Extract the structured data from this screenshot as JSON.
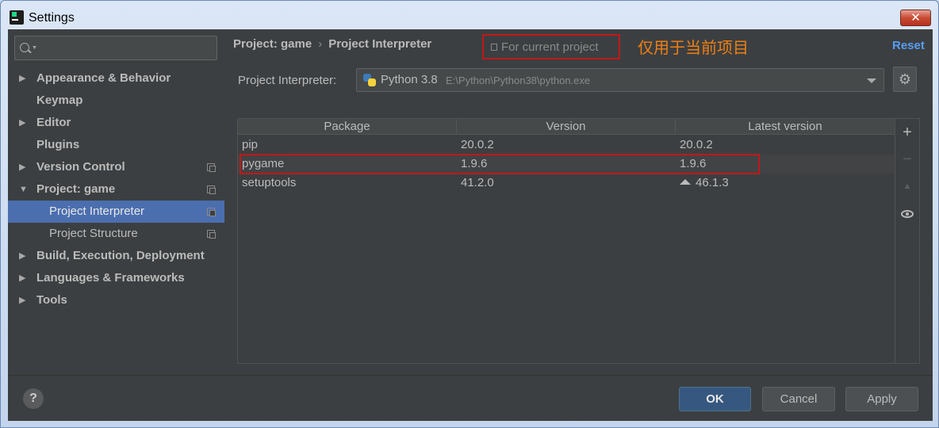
{
  "window": {
    "title": "Settings",
    "close_label": "✕"
  },
  "search": {
    "placeholder": ""
  },
  "sidebar": {
    "items": [
      {
        "label": "Appearance & Behavior",
        "arrow": "▶",
        "bold": true
      },
      {
        "label": "Keymap",
        "arrow": "",
        "bold": true
      },
      {
        "label": "Editor",
        "arrow": "▶",
        "bold": true
      },
      {
        "label": "Plugins",
        "arrow": "",
        "bold": true
      },
      {
        "label": "Version Control",
        "arrow": "▶",
        "bold": true,
        "project_icon": true
      },
      {
        "label": "Project: game",
        "arrow": "▼",
        "bold": true,
        "project_icon": true
      },
      {
        "label": "Project Interpreter",
        "arrow": "",
        "bold": false,
        "child": true,
        "selected": true,
        "project_icon": true
      },
      {
        "label": "Project Structure",
        "arrow": "",
        "bold": false,
        "child": true,
        "project_icon": true
      },
      {
        "label": "Build, Execution, Deployment",
        "arrow": "▶",
        "bold": true
      },
      {
        "label": "Languages & Frameworks",
        "arrow": "▶",
        "bold": true
      },
      {
        "label": "Tools",
        "arrow": "▶",
        "bold": true
      }
    ]
  },
  "header": {
    "breadcrumb": [
      "Project: game",
      "›",
      "Project Interpreter"
    ],
    "scope_text": "For current project",
    "annotation": "仅用于当前项目",
    "reset_label": "Reset"
  },
  "interpreter": {
    "label": "Project Interpreter:",
    "name": "Python 3.8",
    "path": "E:\\Python\\Python38\\python.exe"
  },
  "table": {
    "headers": [
      "Package",
      "Version",
      "Latest version"
    ],
    "rows": [
      {
        "package": "pip",
        "version": "20.0.2",
        "latest": "20.0.2",
        "upgrade": false
      },
      {
        "package": "pygame",
        "version": "1.9.6",
        "latest": "1.9.6",
        "upgrade": false
      },
      {
        "package": "setuptools",
        "version": "41.2.0",
        "latest": "46.1.3",
        "upgrade": true
      }
    ]
  },
  "toolbar": {
    "add": "+",
    "remove": "−",
    "upgrade": "▲"
  },
  "footer": {
    "help": "?",
    "ok": "OK",
    "cancel": "Cancel",
    "apply": "Apply"
  },
  "colors": {
    "accent": "#4b6eaf",
    "link": "#589df6",
    "highlight_box": "#c0181a",
    "annotation": "#ee7f14"
  }
}
